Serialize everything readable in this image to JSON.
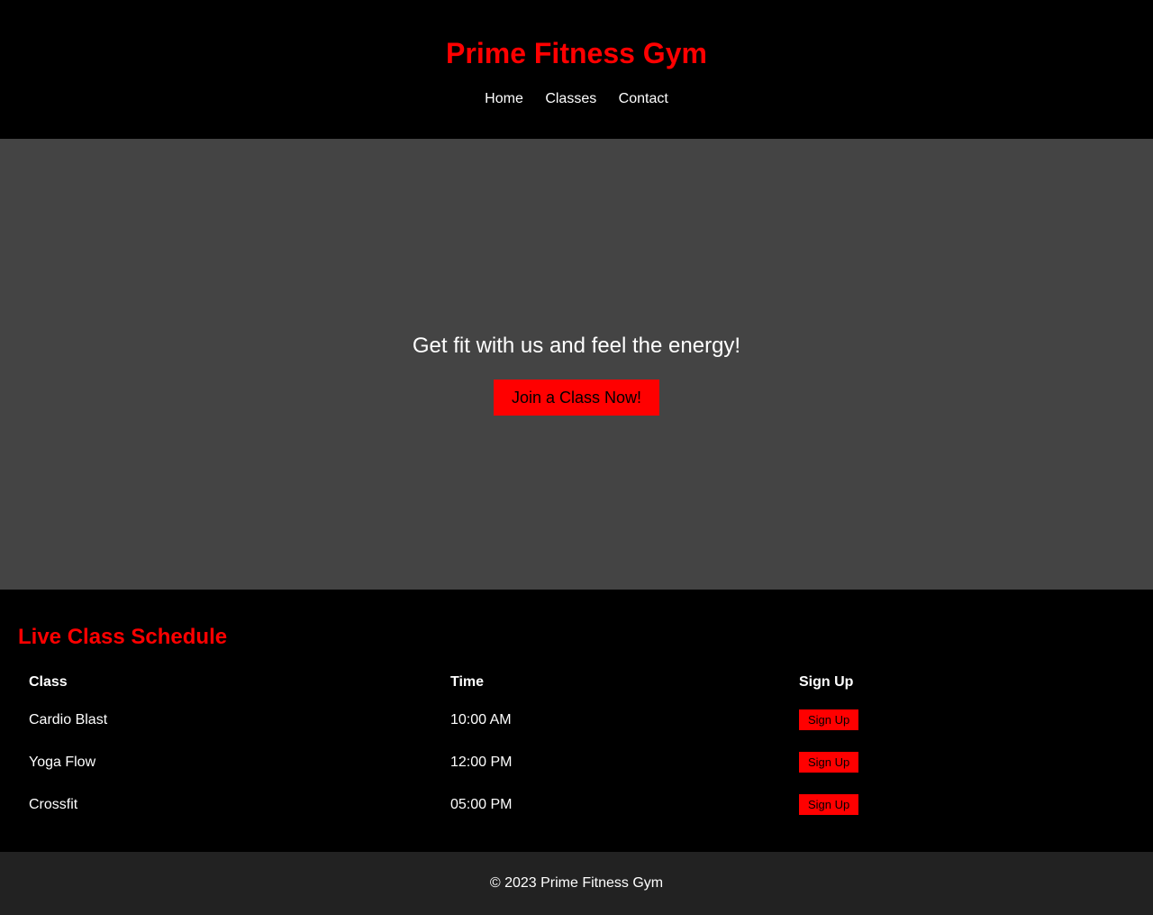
{
  "header": {
    "title": "Prime Fitness Gym",
    "nav": [
      "Home",
      "Classes",
      "Contact"
    ]
  },
  "hero": {
    "tagline": "Get fit with us and feel the energy!",
    "cta_label": "Join a Class Now!"
  },
  "schedule": {
    "title": "Live Class Schedule",
    "columns": [
      "Class",
      "Time",
      "Sign Up"
    ],
    "rows": [
      {
        "class": "Cardio Blast",
        "time": "10:00 AM",
        "action": "Sign Up"
      },
      {
        "class": "Yoga Flow",
        "time": "12:00 PM",
        "action": "Sign Up"
      },
      {
        "class": "Crossfit",
        "time": "05:00 PM",
        "action": "Sign Up"
      }
    ]
  },
  "footer": {
    "text": "© 2023 Prime Fitness Gym"
  },
  "colors": {
    "accent": "#ff0000",
    "background": "#000000",
    "hero_background": "#444444",
    "footer_background": "#222222",
    "text": "#ffffff"
  }
}
